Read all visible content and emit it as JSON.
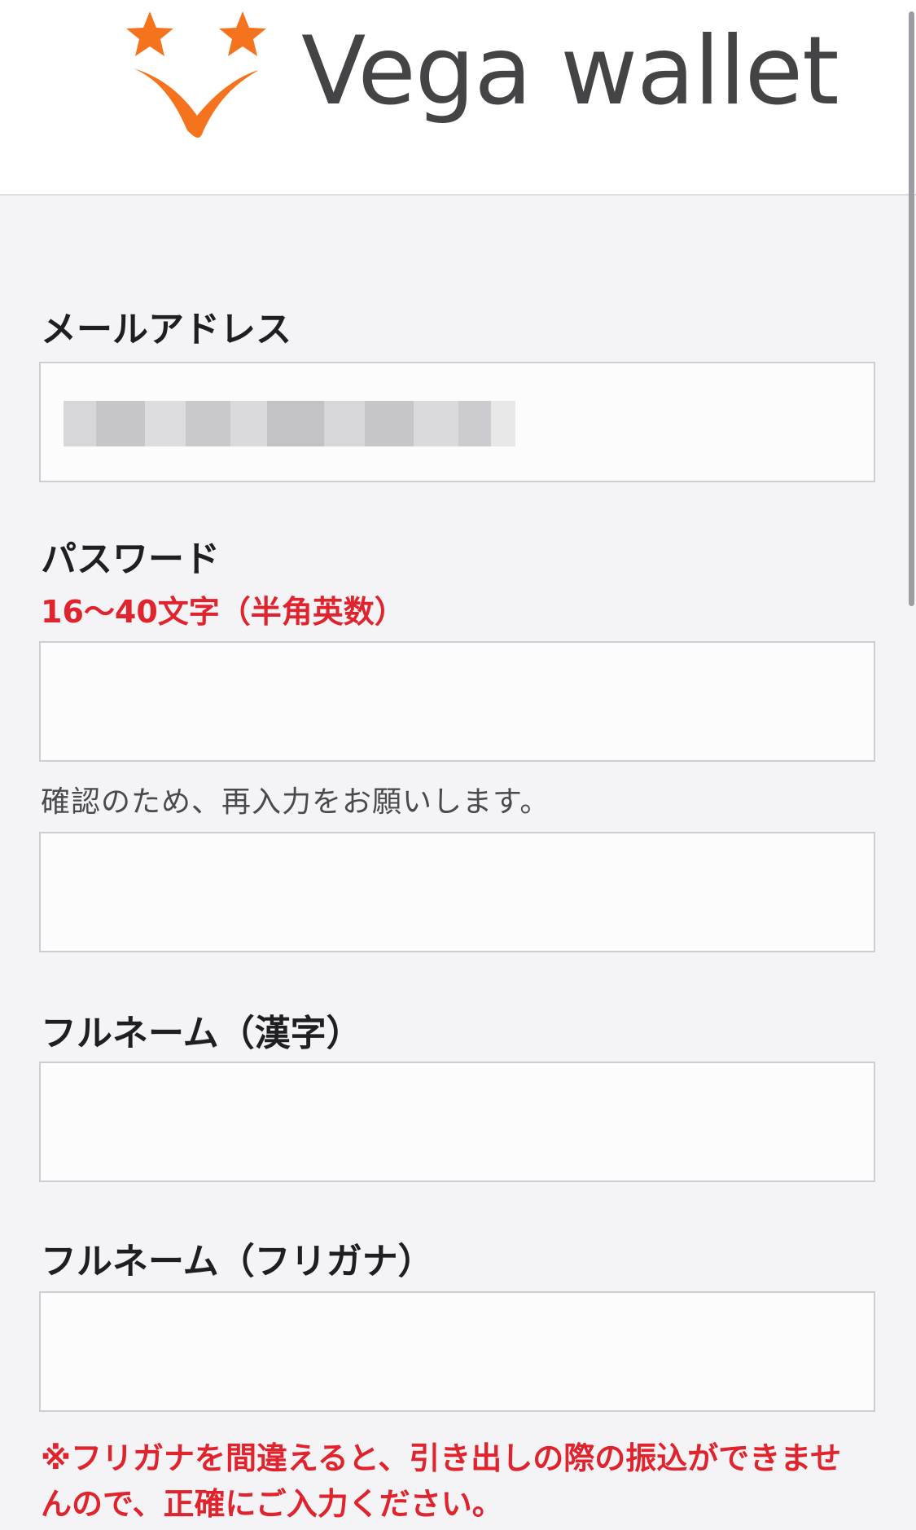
{
  "header": {
    "brand_name": "Vega wallet",
    "logo_icon": "vega-stars-check-logo",
    "accent_color": "#f5731d"
  },
  "form": {
    "email": {
      "label": "メールアドレス",
      "value_state": "blurred"
    },
    "password": {
      "label": "パスワード",
      "requirement": "16〜40文字（半角英数）",
      "confirm_hint": "確認のため、再入力をお願いします。"
    },
    "full_name_kanji": {
      "label": "フルネーム（漢字）"
    },
    "full_name_kana": {
      "label": "フルネーム（フリガナ）"
    },
    "kana_warning": "※フリガナを間違えると、引き出しの際の振込ができませんので、正確にご入力ください。"
  },
  "colors": {
    "required_red": "#e0242e",
    "label_text": "#1f1f21",
    "page_bg": "#f4f4f6"
  }
}
